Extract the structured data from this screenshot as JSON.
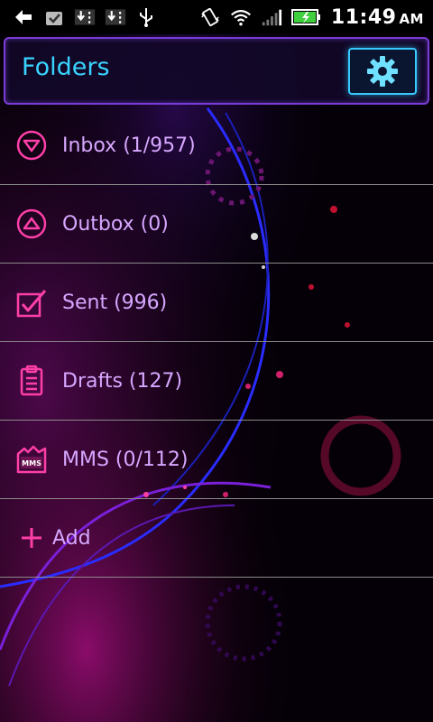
{
  "status_bar": {
    "time": "11:49",
    "ampm": "AM"
  },
  "header": {
    "title": "Folders"
  },
  "folders": [
    {
      "label": "Inbox (1/957)",
      "icon": "inbox-arrow-down-icon"
    },
    {
      "label": "Outbox (0)",
      "icon": "outbox-arrow-up-icon"
    },
    {
      "label": "Sent (996)",
      "icon": "sent-check-icon"
    },
    {
      "label": "Drafts (127)",
      "icon": "drafts-clipboard-icon"
    },
    {
      "label": "MMS (0/112)",
      "icon": "mms-icon",
      "badge": "MMS"
    }
  ],
  "add": {
    "label": "Add"
  },
  "colors": {
    "accent_pink": "#ff3fa8",
    "label_purple": "#d6a7ff",
    "title_cyan": "#39d3ff"
  }
}
